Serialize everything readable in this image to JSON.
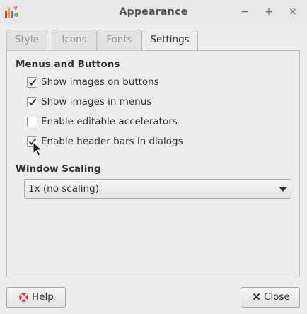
{
  "window": {
    "title": "Appearance",
    "minimize_glyph": "−",
    "maximize_glyph": "+",
    "close_glyph": "×",
    "app_icon": "appearance-palette-icon"
  },
  "tabs": [
    {
      "label": "Style",
      "active": false
    },
    {
      "label": "Icons",
      "active": false
    },
    {
      "label": "Fonts",
      "active": false
    },
    {
      "label": "Settings",
      "active": true
    }
  ],
  "menus_buttons": {
    "title": "Menus and Buttons",
    "options": [
      {
        "label": "Show images on buttons",
        "checked": true
      },
      {
        "label": "Show images in menus",
        "checked": true
      },
      {
        "label": "Enable editable accelerators",
        "checked": false
      },
      {
        "label": "Enable header bars in dialogs",
        "checked": true
      }
    ]
  },
  "window_scaling": {
    "title": "Window Scaling",
    "selected": "1x (no scaling)"
  },
  "buttons": {
    "help_label": "Help",
    "close_label": "Close"
  }
}
